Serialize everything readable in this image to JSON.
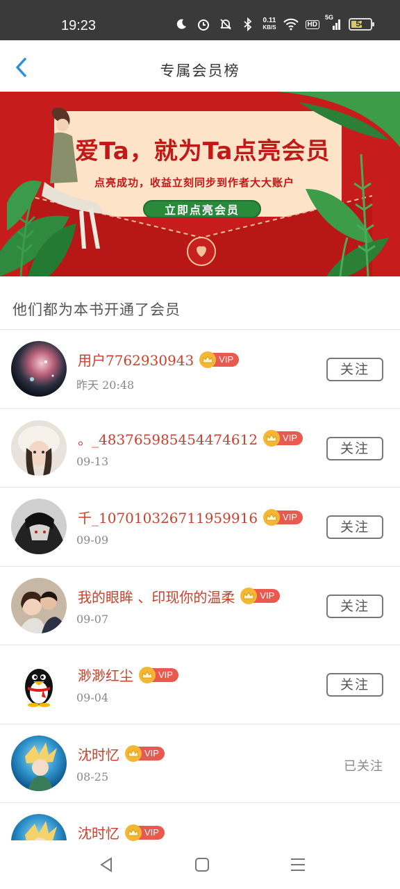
{
  "status_bar": {
    "time": "19:23",
    "net_speed_value": "0.11",
    "net_speed_unit": "KB/S",
    "hd_label": "HD",
    "signal_label": "5G",
    "battery": "54",
    "icons": [
      "moon-icon",
      "alarm-icon",
      "mute-icon",
      "bluetooth-icon",
      "wifi-icon",
      "signal-icon",
      "battery-icon"
    ]
  },
  "header": {
    "title": "专属会员榜"
  },
  "banner": {
    "headline": "爱Ta，就为Ta点亮会员",
    "subtitle": "点亮成功，收益立刻同步到作者大大账户",
    "button_label": "立即点亮会员"
  },
  "section": {
    "label": "他们都为本书开通了会员"
  },
  "vip_label": "VIP",
  "members": [
    {
      "name": "用户7762930943",
      "date": "昨天 20:48",
      "action": "关注",
      "followed": false,
      "avatar": "nebula"
    },
    {
      "name": "。_483765985454474612",
      "date": "09-13",
      "action": "关注",
      "followed": false,
      "avatar": "girl-hat"
    },
    {
      "name": "千_107010326711959916",
      "date": "09-09",
      "action": "关注",
      "followed": false,
      "avatar": "dark-anime"
    },
    {
      "name": "我的眼眸 、印现你的温柔",
      "date": "09-07",
      "action": "关注",
      "followed": false,
      "avatar": "couple"
    },
    {
      "name": "渺渺红尘",
      "date": "09-04",
      "action": "关注",
      "followed": false,
      "avatar": "penguin"
    },
    {
      "name": "沈时忆",
      "date": "08-25",
      "action": "已关注",
      "followed": true,
      "avatar": "anime-blue"
    },
    {
      "name": "沈时忆",
      "date": "",
      "action": "",
      "followed": true,
      "avatar": "anime-blue"
    }
  ],
  "colors": {
    "accent_blue": "#2a8fd6",
    "name_red": "#c8412c",
    "vip_red": "#e85a4f",
    "crown_gold": "#f4b733",
    "banner_red": "#c61c1c",
    "banner_green": "#2a8a3c"
  }
}
